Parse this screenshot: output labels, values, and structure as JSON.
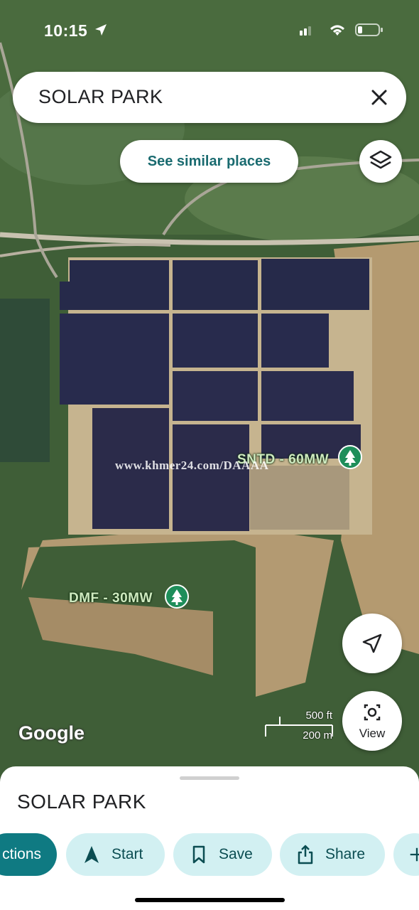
{
  "status_bar": {
    "time": "10:15"
  },
  "search": {
    "query": "SOLAR PARK"
  },
  "similar_places_label": "See similar places",
  "map": {
    "pins": [
      {
        "label": "SNTD - 60MW",
        "icon": "tree-pin-icon"
      },
      {
        "label": "DMF - 30MW",
        "icon": "tree-pin-icon"
      }
    ],
    "watermark": "www.khmer24.com/DAAAA",
    "attribution": "Google",
    "scale": {
      "feet": "500 ft",
      "meters": "200 m"
    },
    "view_button_label": "View"
  },
  "sheet": {
    "title": "SOLAR PARK",
    "actions": {
      "directions": "ctions",
      "start": "Start",
      "save": "Save",
      "share": "Share"
    }
  },
  "colors": {
    "accent": "#0f7a82",
    "chip_bg": "#d2f0f2",
    "link": "#1a6b70"
  }
}
